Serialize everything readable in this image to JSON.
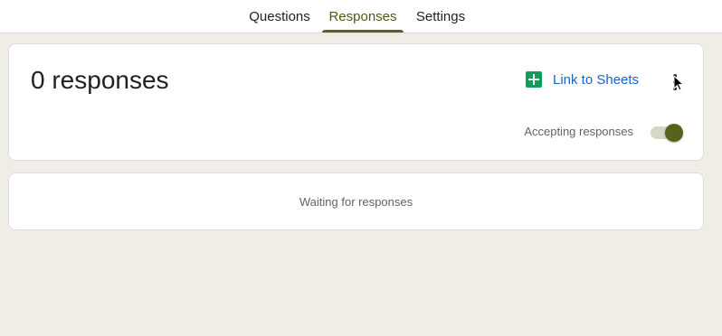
{
  "tabs": [
    {
      "label": "Questions",
      "active": false
    },
    {
      "label": "Responses",
      "active": true
    },
    {
      "label": "Settings",
      "active": false
    }
  ],
  "summary": {
    "count_text": "0 responses",
    "link_label": "Link to Sheets",
    "link_icon": "google-sheets-icon",
    "more_icon": "more-vert-icon",
    "accepting_label": "Accepting responses",
    "accepting_on": true
  },
  "waiting": {
    "text": "Waiting for responses"
  },
  "colors": {
    "accent": "#56631a",
    "link": "#1a63c6",
    "sheets_green": "#0f9d58",
    "background": "#efede6"
  }
}
